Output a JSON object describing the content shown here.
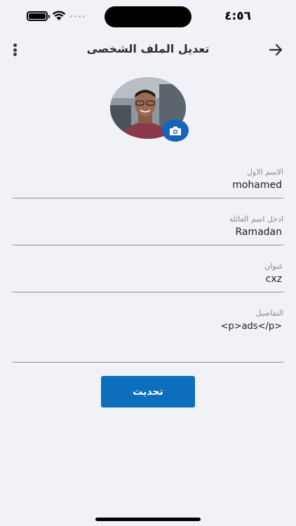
{
  "status_bar": {
    "time": "٤:٥٦"
  },
  "header": {
    "title": "تعديل الملف الشخصى"
  },
  "profile": {
    "avatar_alt": "user photo"
  },
  "form": {
    "first_name": {
      "label": "الاسم الاول",
      "value": "mohamed"
    },
    "last_name": {
      "label": "ادخل اسم العائلة",
      "value": "Ramadan"
    },
    "address": {
      "label": "عنوان",
      "value": "cxz"
    },
    "details": {
      "label": "التفاصيل",
      "value": "<p>ads</p>"
    }
  },
  "actions": {
    "update_label": "تحديث"
  },
  "colors": {
    "background": "#f1f2f7",
    "accent": "#0d6ebd",
    "camera": "#1565b8"
  }
}
